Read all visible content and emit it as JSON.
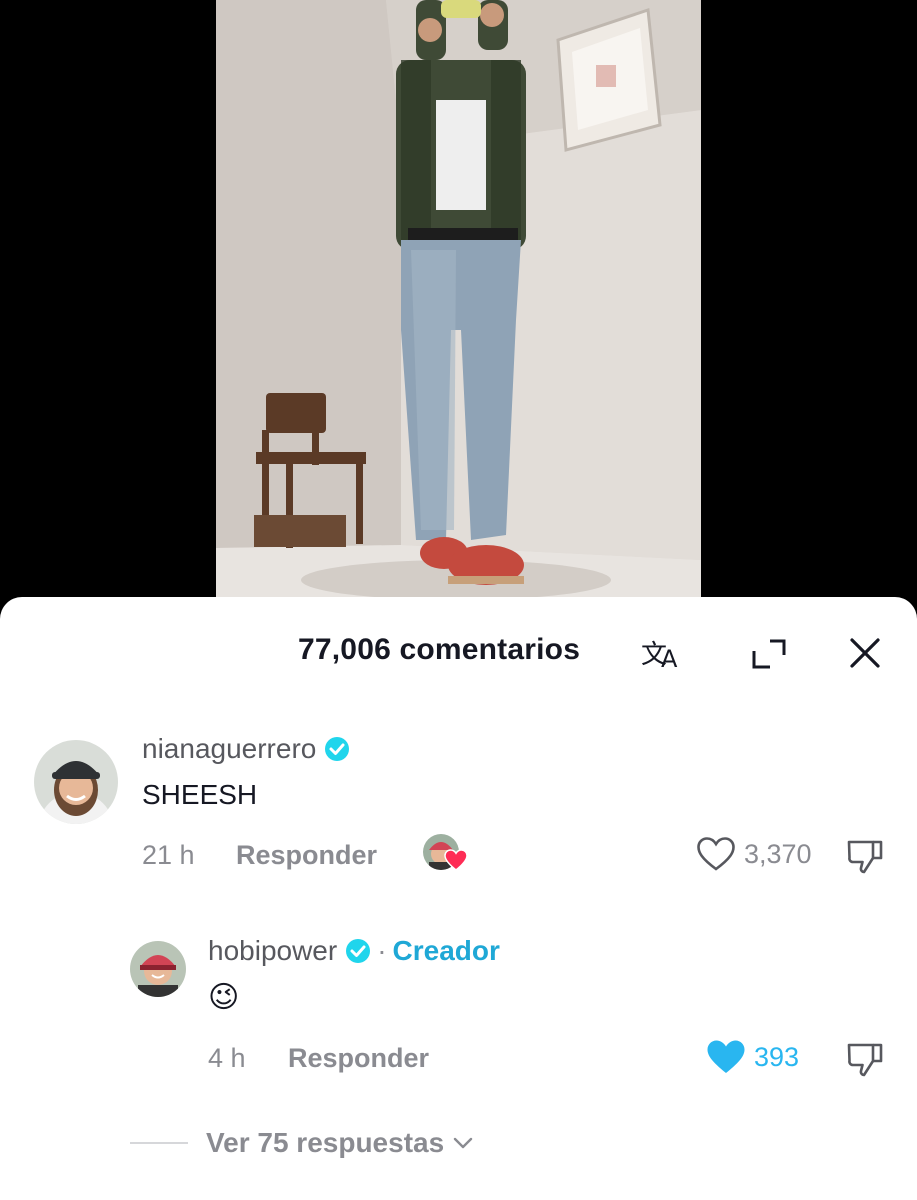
{
  "comments_header": {
    "count_label": "77,006 comentarios"
  },
  "comments": [
    {
      "username": "nianaguerrero",
      "text": "SHEESH",
      "time": "21 h",
      "reply_label": "Responder",
      "likes": "3,370",
      "liked": false
    },
    {
      "username": "hobipower",
      "separator": "·",
      "creator_label": "Creador",
      "text": "😉",
      "time": "4 h",
      "reply_label": "Responder",
      "likes": "393",
      "liked": true
    }
  ],
  "view_replies_label": "Ver 75 respuestas",
  "colors": {
    "accent_blue": "#29b6f0",
    "creator_blue": "#1fa8d6",
    "verified_blue": "#20d5ec",
    "heart_red": "#fe2c55"
  },
  "icons": {
    "translate": "translate-icon",
    "expand": "expand-icon",
    "close": "close-icon",
    "like": "heart-icon",
    "dislike": "thumbs-down-icon",
    "verified": "verified-badge-icon",
    "chevron": "chevron-down-icon"
  }
}
